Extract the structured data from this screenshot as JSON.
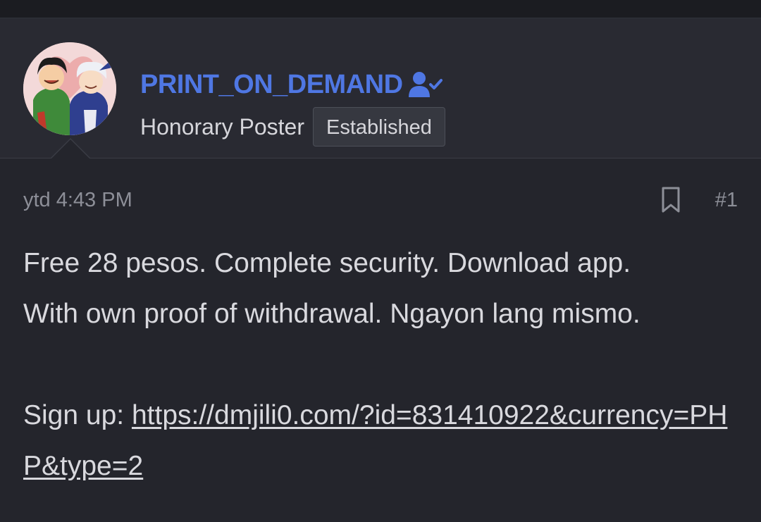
{
  "author": {
    "username": "PRINT_ON_DEMAND",
    "user_title": "Honorary Poster",
    "badge": "Established",
    "username_color": "#4f77e3",
    "avatar_icon": "avatar-anime-illustration",
    "verified_icon": "user-check-icon"
  },
  "post": {
    "timestamp": "ytd 4:43 PM",
    "post_number": "#1",
    "bookmark_icon": "bookmark-icon",
    "line1": "Free 28 pesos. Complete security. Download app.",
    "line2": "With own proof of withdrawal. Ngayon lang mismo.",
    "signup_label": "Sign up: ",
    "link_text": "https://dmjili0.com/?id=831410922&currency=PHP&type=2"
  }
}
